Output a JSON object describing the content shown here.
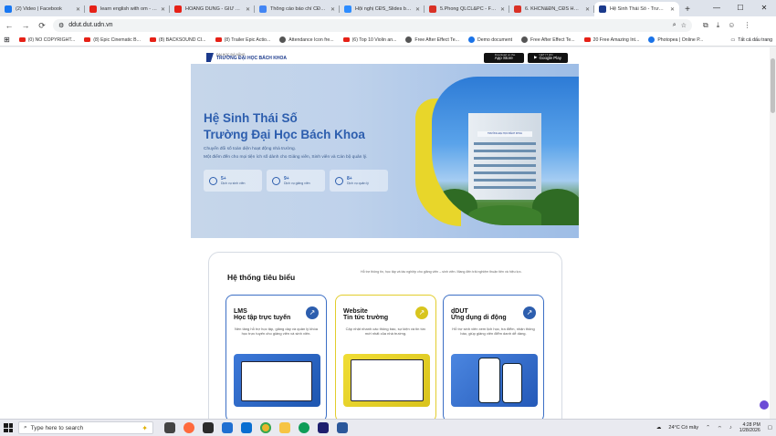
{
  "browser": {
    "tabs": [
      {
        "label": "(2) Video | Facebook",
        "color": "#1877f2",
        "active": false
      },
      {
        "label": "learn english with om - Y...",
        "color": "#e62117",
        "active": false
      },
      {
        "label": "HOÀNG DŨNG - GIỮ ANH...",
        "color": "#e62117",
        "active": false
      },
      {
        "label": "Thông cáo báo chí CĐS 2...",
        "color": "#4285f4",
        "active": false
      },
      {
        "label": "Hội nghị CĐS_Slides báo...",
        "color": "#2d8cff",
        "active": false
      },
      {
        "label": "5.Phong QLCL&PC - Fina...",
        "color": "#d93025",
        "active": false
      },
      {
        "label": "6. KHCN&ĐN_CĐS HTQT...",
        "color": "#d93025",
        "active": false
      },
      {
        "label": "Hệ Sinh Thái Số - Trường...",
        "color": "#1b3a8c",
        "active": true
      }
    ],
    "new_tab": "+",
    "window_controls": [
      "—",
      "☐",
      "✕"
    ],
    "back": "←",
    "forward": "→",
    "reload": "⟳",
    "url": "ddut.dut.udn.vn",
    "bookmarks": [
      {
        "label": "(0) NO COPYRIGHT...",
        "kind": "yt"
      },
      {
        "label": "(8) Epic Cinematic B...",
        "kind": "yt"
      },
      {
        "label": "(8) BACKSOUND CI...",
        "kind": "yt"
      },
      {
        "label": "(8) Trailer Epic Actio...",
        "kind": "yt"
      },
      {
        "label": "Attendance Icon fre...",
        "kind": "grey"
      },
      {
        "label": "(6) Top 10 Violin an...",
        "kind": "yt"
      },
      {
        "label": "Free After Effect Te...",
        "kind": "grey"
      },
      {
        "label": "Demo document",
        "kind": "blue"
      },
      {
        "label": "Free After Effect Te...",
        "kind": "grey"
      },
      {
        "label": "20 Free Amazing Int...",
        "kind": "yt"
      },
      {
        "label": "Photopea | Online P...",
        "kind": "blue"
      }
    ],
    "all_bookmarks": "Tất cả dấu trang"
  },
  "site": {
    "logo_small": "ĐẠI HỌC ĐÀ NẴNG",
    "logo_big": "TRƯỜNG ĐẠI HỌC BÁCH KHOA",
    "stores": [
      {
        "sub": "Download on the",
        "name": "App Store"
      },
      {
        "sub": "GET IT ON",
        "name": "Google Play"
      }
    ],
    "hero": {
      "title_line1": "Hệ Sinh Thái Số",
      "title_line2": "Trường Đại Học Bách Khoa",
      "sub_line1": "Chuyển đổi số toàn diện hoạt động nhà trường.",
      "sub_line2": "Một điểm đến cho mọi tiện ích số dành cho Giảng viên, Sinh viên và Cán bộ quản lý.",
      "stats": [
        {
          "value": "5+",
          "label": "Dịch vụ sinh viên"
        },
        {
          "value": "9+",
          "label": "Dịch vụ giảng viên"
        },
        {
          "value": "8+",
          "label": "Dịch vụ quản lý"
        }
      ],
      "building_sign": "TRƯỜNG ĐẠI HỌC BÁCH KHOA"
    },
    "section": {
      "title": "Hệ thống tiêu biểu",
      "desc": "Hỗ trợ thông tin, học tập và tác nghiệp cho giảng viên – sinh viên. Mang đến trải nghiệm thuận tiện và hiệu lực.",
      "cards": [
        {
          "title1": "LMS",
          "title2": "Học tập trực tuyến",
          "desc": "Nền tảng hỗ trợ học tập, giảng dạy và quản lý khóa học trực tuyến cho giảng viên và sinh viên.",
          "arrow": "↗"
        },
        {
          "title1": "Website",
          "title2": "Tin tức trường",
          "desc": "Cập nhật nhanh các thông báo, sự kiện và tin tức mới nhất của nhà trường.",
          "arrow": "↗"
        },
        {
          "title1": "dDUT",
          "title2": "Ứng dụng di động",
          "desc": "Hỗ trợ sinh viên xem lịch học, tra điểm, nhận thông báo, giúp giảng viên điểm danh dễ dàng.",
          "arrow": "↗"
        }
      ]
    }
  },
  "taskbar": {
    "search_placeholder": "Type here to search",
    "weather": "24°C  Có mây",
    "time": "4:28 PM",
    "date": "1/28/2026"
  }
}
